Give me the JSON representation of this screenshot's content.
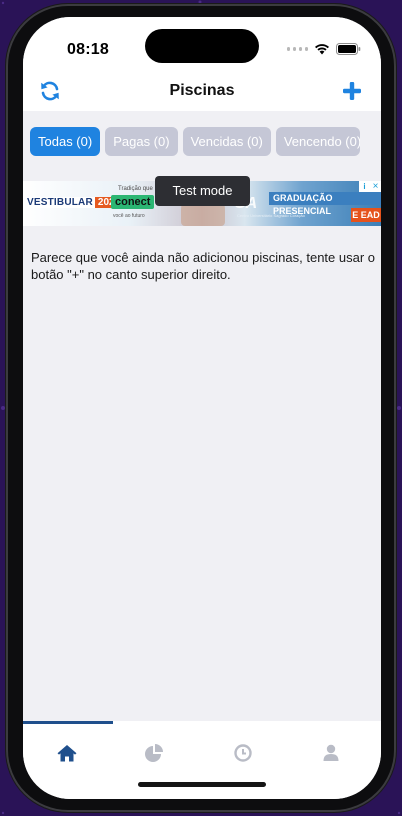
{
  "status_bar": {
    "time": "08:18"
  },
  "header": {
    "title": "Piscinas",
    "refresh_icon": "refresh-icon",
    "add_icon": "plus-icon"
  },
  "filters": [
    {
      "label": "Todas (0)",
      "active": true
    },
    {
      "label": "Pagas (0)",
      "active": false
    },
    {
      "label": "Vencidas (0)",
      "active": false
    },
    {
      "label": "Vencendo (0)",
      "active": false
    }
  ],
  "ad": {
    "left_label": "VESTIBULAR",
    "year": "2025",
    "tagline_small": "Tradição que",
    "highlight": "conect",
    "subline": "você ao futuro",
    "brand": "SA",
    "brand_sub": "Centro Universitário Sagrado Coração",
    "right_label": "GRADUAÇÃO PRESENCIAL",
    "right_sub": "E EAD",
    "info_icon": "info-icon",
    "close_icon": "close-icon"
  },
  "test_mode_label": "Test mode",
  "empty_message": "Parece que você ainda não adicionou piscinas, tente usar o botão \"+\" no canto superior direito.",
  "tabbar": {
    "items": [
      {
        "icon": "home-icon",
        "active": true
      },
      {
        "icon": "pie-chart-icon",
        "active": false
      },
      {
        "icon": "clock-icon",
        "active": false
      },
      {
        "icon": "user-icon",
        "active": false
      }
    ],
    "active_color": "#1f4f8c",
    "inactive_color": "#b9bcc6"
  },
  "colors": {
    "accent": "#1f83e0",
    "chip_inactive": "#c5c7d6",
    "background": "#f0f0f4"
  }
}
